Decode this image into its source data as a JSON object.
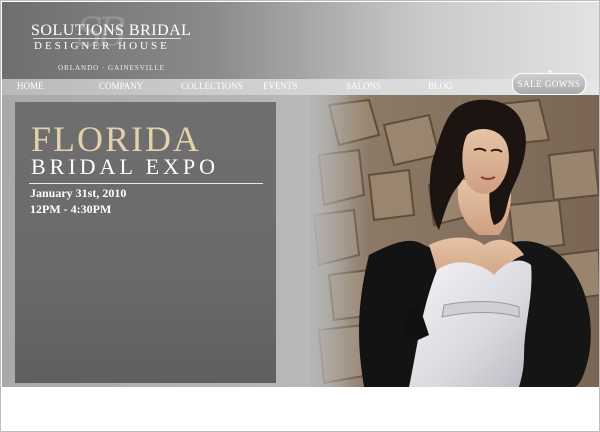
{
  "header": {
    "logo_title": "SOLUTIONS BRIDAL",
    "logo_subtitle": "DESIGNER HOUSE",
    "logo_locations": "ORLANDO · GAINESVILLE"
  },
  "nav": {
    "items": [
      {
        "label": "HOME"
      },
      {
        "label": "COMPANY"
      },
      {
        "label": "COLLECTIONS"
      },
      {
        "label": "EVENTS"
      },
      {
        "label": "SALONS"
      },
      {
        "label": "BLOG"
      }
    ],
    "sale_label": "SALE GOWNS"
  },
  "promo": {
    "title": "FLORIDA",
    "subtitle": "BRIDAL EXPO",
    "date": "January 31st, 2010",
    "time": "12PM - 4:30PM"
  },
  "colors": {
    "title_gold": "#e3d0ac",
    "panel_gray": "#6f6f6f"
  },
  "icons": {
    "logo_mark": "monogram-sb-icon",
    "sale_ornament": "fleur-ornament-icon"
  }
}
